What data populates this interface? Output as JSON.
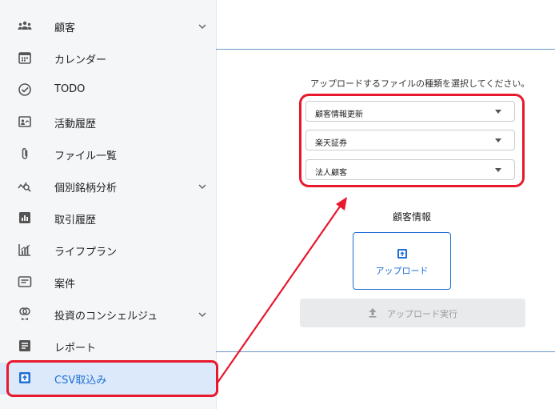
{
  "sidebar": {
    "items": [
      {
        "label": "顧客",
        "icon": "people-icon",
        "expandable": true
      },
      {
        "label": "カレンダー",
        "icon": "calendar-icon",
        "expandable": false
      },
      {
        "label": "TODO",
        "icon": "check-circle-icon",
        "expandable": false
      },
      {
        "label": "活動履歴",
        "icon": "activity-icon",
        "expandable": false
      },
      {
        "label": "ファイル一覧",
        "icon": "paperclip-icon",
        "expandable": false
      },
      {
        "label": "個別銘柄分析",
        "icon": "chart-search-icon",
        "expandable": true
      },
      {
        "label": "取引履歴",
        "icon": "bar-chart-icon",
        "expandable": false
      },
      {
        "label": "ライフプラン",
        "icon": "growth-chart-icon",
        "expandable": false
      },
      {
        "label": "案件",
        "icon": "document-box-icon",
        "expandable": false
      },
      {
        "label": "投資のコンシェルジュ",
        "icon": "concierge-icon",
        "expandable": true
      },
      {
        "label": "レポート",
        "icon": "report-icon",
        "expandable": false
      },
      {
        "label": "CSV取込み",
        "icon": "upload-box-icon",
        "expandable": false,
        "active": true
      }
    ]
  },
  "main": {
    "instruction": "アップロードするファイルの種類を選択してください。",
    "selects": [
      {
        "value": "顧客情報更新"
      },
      {
        "value": "楽天証券"
      },
      {
        "value": "法人顧客"
      }
    ],
    "section_title": "顧客情報",
    "upload_label": "アップロード",
    "execute_label": "アップロード実行"
  },
  "colors": {
    "accent": "#1f6fd6",
    "highlight": "#e8192c",
    "active_bg": "#dce9fb",
    "sidebar_bg": "#f5f6f8"
  }
}
